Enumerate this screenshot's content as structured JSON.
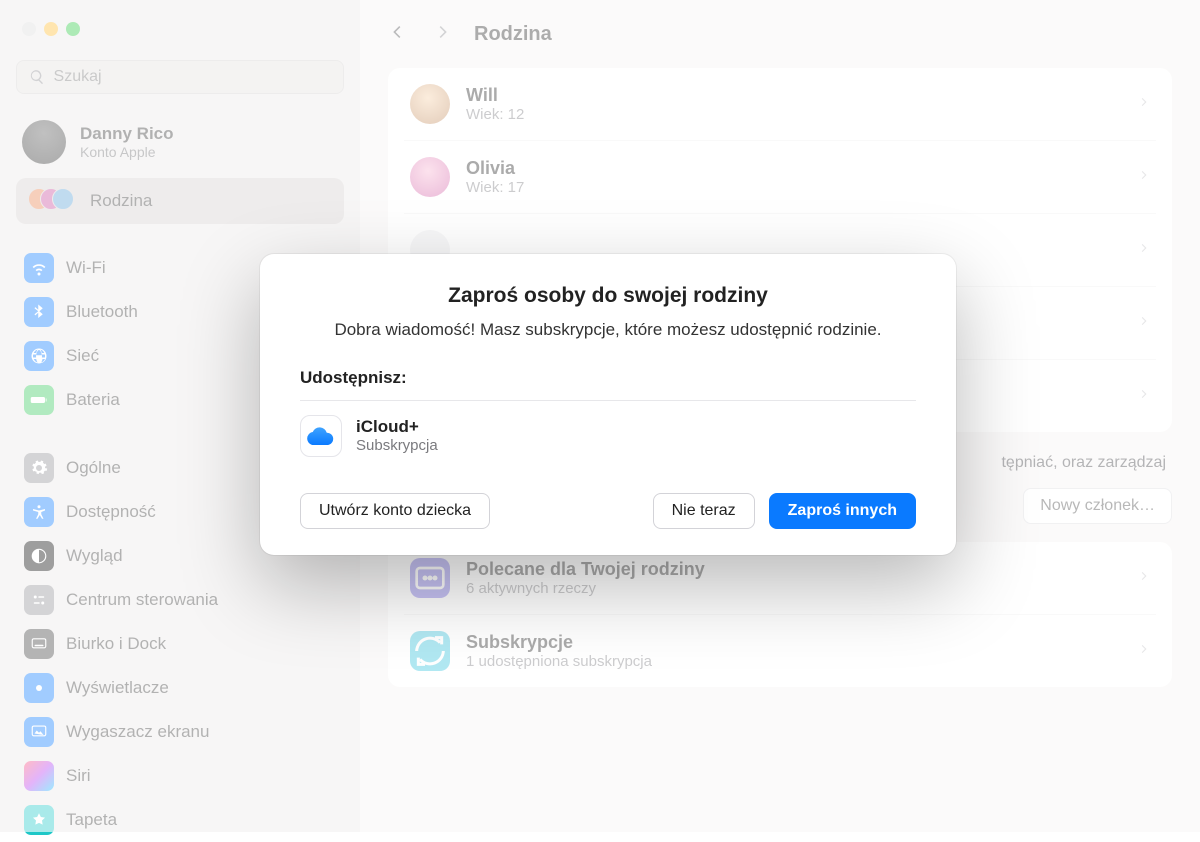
{
  "search": {
    "placeholder": "Szukaj"
  },
  "profile": {
    "name": "Danny Rico",
    "subtitle": "Konto Apple"
  },
  "family_item": {
    "label": "Rodzina"
  },
  "sidebar": {
    "group1": [
      {
        "label": "Wi-Fi",
        "icon": "wifi"
      },
      {
        "label": "Bluetooth",
        "icon": "bt"
      },
      {
        "label": "Sieć",
        "icon": "net"
      },
      {
        "label": "Bateria",
        "icon": "bat"
      }
    ],
    "group2": [
      {
        "label": "Ogólne",
        "icon": "gen"
      },
      {
        "label": "Dostępność",
        "icon": "acc"
      },
      {
        "label": "Wygląd",
        "icon": "app"
      },
      {
        "label": "Centrum sterowania",
        "icon": "cc"
      },
      {
        "label": "Biurko i Dock",
        "icon": "dock"
      },
      {
        "label": "Wyświetlacze",
        "icon": "disp"
      },
      {
        "label": "Wygaszacz ekranu",
        "icon": "ss"
      },
      {
        "label": "Siri",
        "icon": "siri"
      },
      {
        "label": "Tapeta",
        "icon": "wall"
      }
    ]
  },
  "page": {
    "title": "Rodzina"
  },
  "members": [
    {
      "name": "Will",
      "sub": "Wiek: 12"
    },
    {
      "name": "Olivia",
      "sub": "Wiek: 17"
    },
    {
      "name": "",
      "sub": ""
    },
    {
      "name": "",
      "sub": ""
    },
    {
      "name": "",
      "sub": ""
    }
  ],
  "context_hint": "tępniać, oraz zarządzaj",
  "new_member_btn": "Nowy członek…",
  "sections": {
    "recommended": {
      "title": "Polecane dla Twojej rodziny",
      "sub": "6 aktywnych rzeczy"
    },
    "subscriptions": {
      "title": "Subskrypcje",
      "sub": "1 udostępniona subskrypcja"
    }
  },
  "dialog": {
    "title": "Zaproś osoby do swojej rodziny",
    "subtitle": "Dobra wiadomość! Masz subskrypcje, które możesz udostępnić rodzinie.",
    "share_header": "Udostępnisz:",
    "share_item": {
      "name": "iCloud+",
      "sub": "Subskrypcja"
    },
    "btn_child": "Utwórz konto dziecka",
    "btn_later": "Nie teraz",
    "btn_invite": "Zaproś innych"
  }
}
